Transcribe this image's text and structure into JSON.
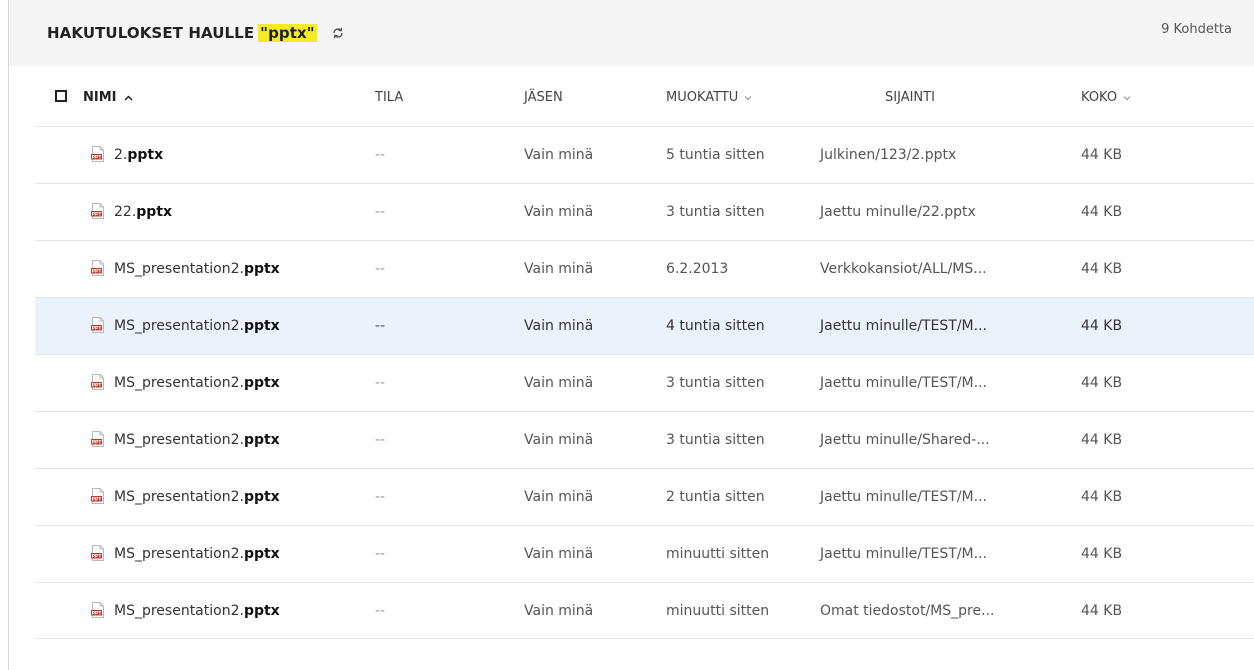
{
  "header": {
    "title_prefix": "HAKUTULOKSET HAULLE",
    "query": "\"pptx\"",
    "count": "9 Kohdetta"
  },
  "columns": {
    "name": "NIMI",
    "status": "TILA",
    "member": "JÄSEN",
    "modified": "MUOKATTU",
    "location": "SIJAINTI",
    "size": "KOKO"
  },
  "rows": [
    {
      "name_base": "2.",
      "name_ext": "pptx",
      "status": "--",
      "member": "Vain minä",
      "modified": "5 tuntia sitten",
      "location": "Julkinen/123/2.pptx",
      "size": "44 KB"
    },
    {
      "name_base": "22.",
      "name_ext": "pptx",
      "status": "--",
      "member": "Vain minä",
      "modified": "3 tuntia sitten",
      "location": "Jaettu minulle/22.pptx",
      "size": "44 KB"
    },
    {
      "name_base": "MS_presentation2.",
      "name_ext": "pptx",
      "status": "--",
      "member": "Vain minä",
      "modified": "6.2.2013",
      "location": "Verkkokansiot/ALL/MS...",
      "size": "44 KB"
    },
    {
      "name_base": "MS_presentation2.",
      "name_ext": "pptx",
      "status": "--",
      "member": "Vain minä",
      "modified": "4 tuntia sitten",
      "location": "Jaettu minulle/TEST/M...",
      "size": "44 KB"
    },
    {
      "name_base": "MS_presentation2.",
      "name_ext": "pptx",
      "status": "--",
      "member": "Vain minä",
      "modified": "3 tuntia sitten",
      "location": "Jaettu minulle/TEST/M...",
      "size": "44 KB"
    },
    {
      "name_base": "MS_presentation2.",
      "name_ext": "pptx",
      "status": "--",
      "member": "Vain minä",
      "modified": "3 tuntia sitten",
      "location": "Jaettu minulle/Shared-...",
      "size": "44 KB"
    },
    {
      "name_base": "MS_presentation2.",
      "name_ext": "pptx",
      "status": "--",
      "member": "Vain minä",
      "modified": "2 tuntia sitten",
      "location": "Jaettu minulle/TEST/M...",
      "size": "44 KB"
    },
    {
      "name_base": "MS_presentation2.",
      "name_ext": "pptx",
      "status": "--",
      "member": "Vain minä",
      "modified": "minuutti sitten",
      "location": "Jaettu minulle/TEST/M...",
      "size": "44 KB"
    },
    {
      "name_base": "MS_presentation2.",
      "name_ext": "pptx",
      "status": "--",
      "member": "Vain minä",
      "modified": "minuutti sitten",
      "location": "Omat tiedostot/MS_pre...",
      "size": "44 KB"
    }
  ],
  "selected_row": 3,
  "colors": {
    "highlight": "#f3ec24",
    "selected_row": "#eaf3fc",
    "ppt_icon": "#c0392b"
  },
  "icons": {
    "refresh": "refresh-icon",
    "file": "ppt-file-icon",
    "sort_asc": "chevron-up-icon",
    "sort_desc": "chevron-down-icon"
  }
}
